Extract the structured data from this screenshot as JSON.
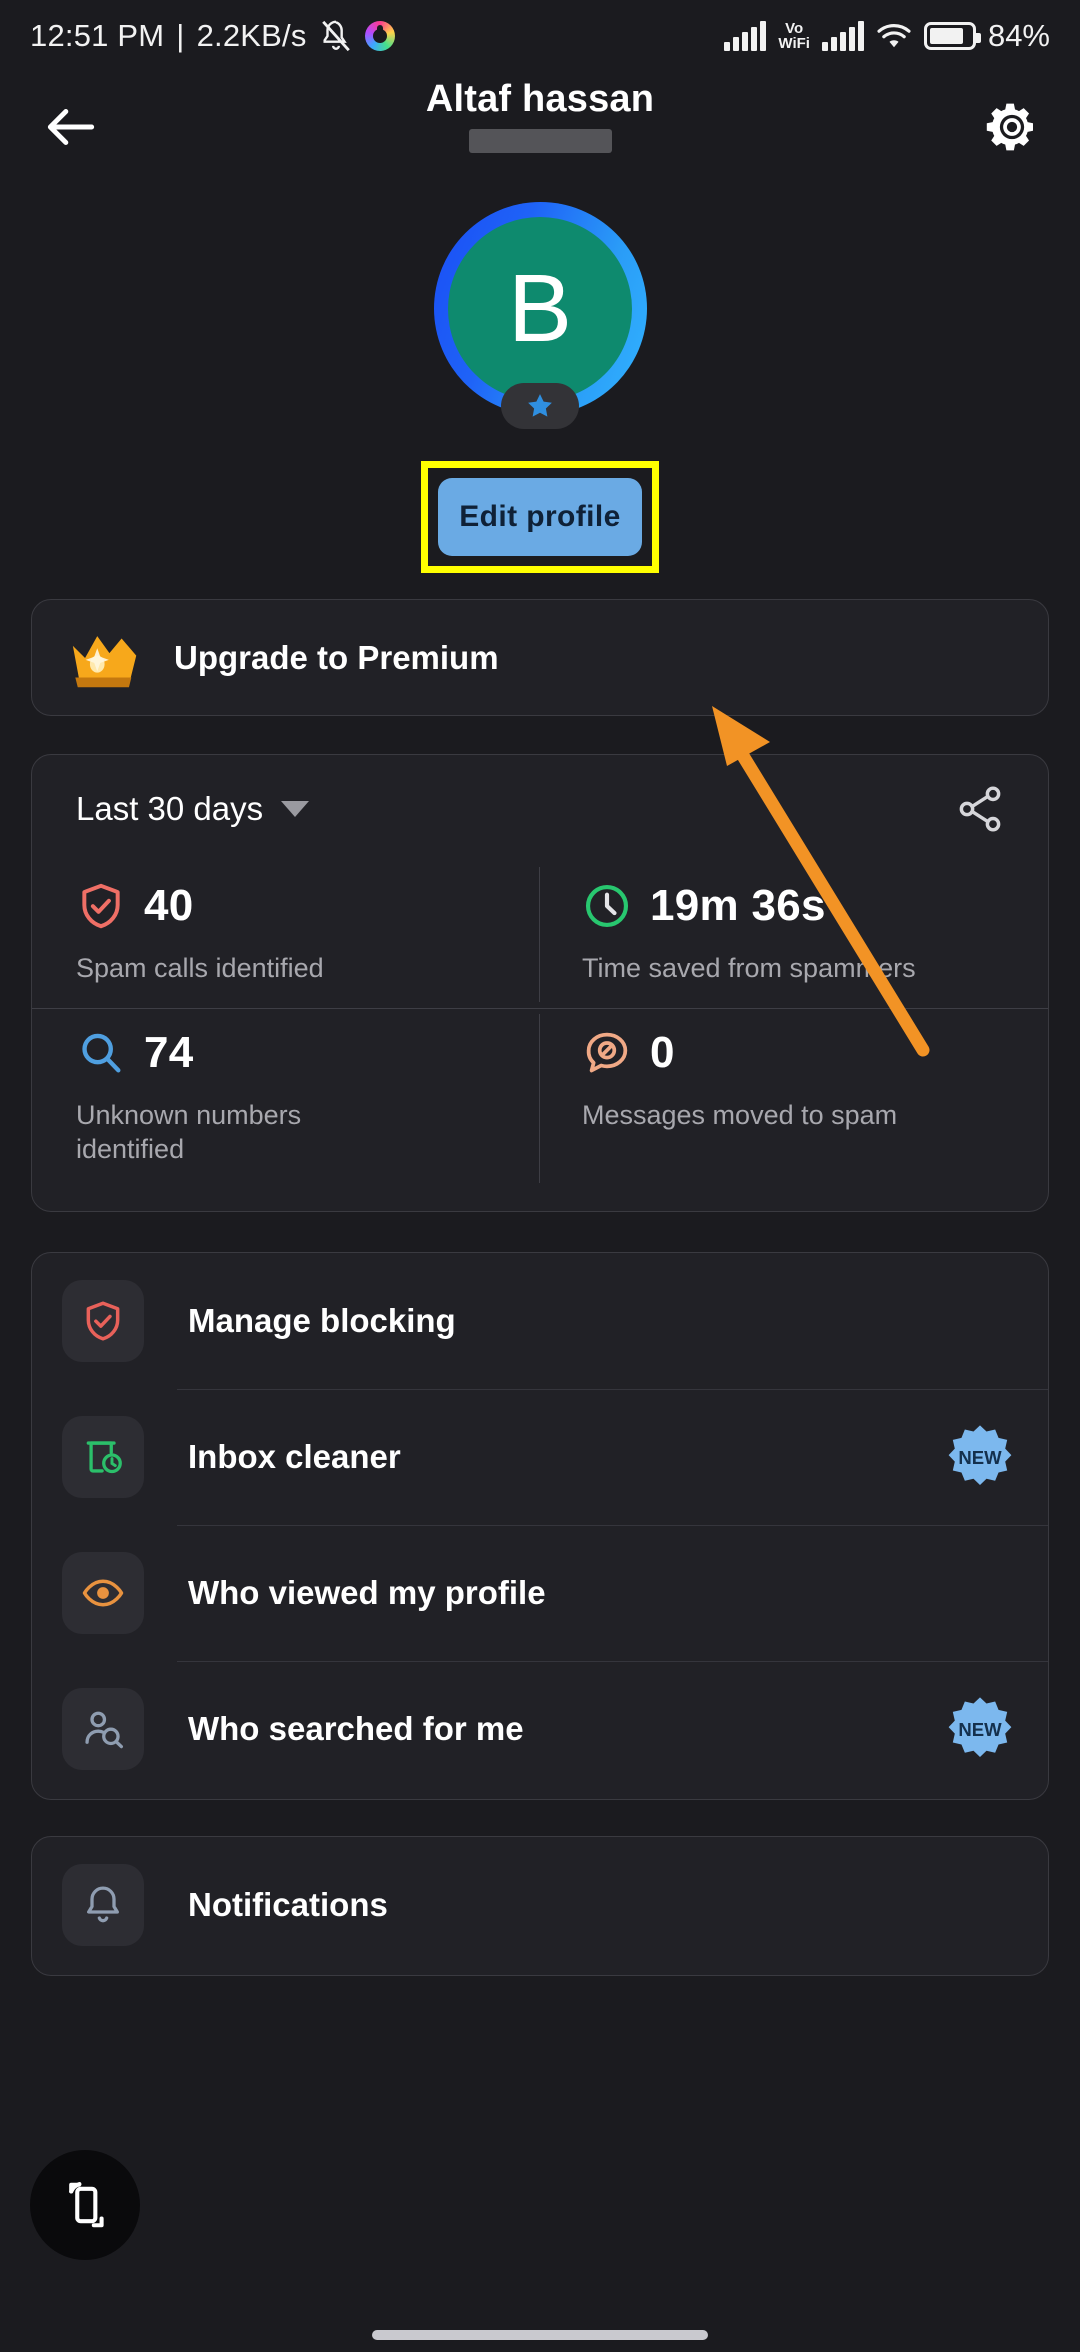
{
  "status_bar": {
    "time": "12:51 PM",
    "separator": "|",
    "network_speed": "2.2KB/s",
    "mute_icon": "bell-muted-icon",
    "app_icon": "spiral-app-icon",
    "signal_icon": "signal-bars-icon",
    "volte_line1": "Vo",
    "volte_line2": "WiFi",
    "signal2_icon": "signal-bars-2-icon",
    "wifi_icon": "wifi-icon",
    "battery_icon": "battery-icon",
    "battery_percent": "84%"
  },
  "app_bar": {
    "back_icon": "back-arrow-icon",
    "title": "Altaf hassan",
    "subtitle_redacted": "",
    "settings_icon": "gear-icon"
  },
  "profile": {
    "avatar_letter": "B",
    "avatar_bg_color": "#0e8a6e",
    "ring_color_start": "#1a4ef5",
    "ring_color_end": "#32b4ff",
    "badge_icon": "star-icon",
    "badge_color": "#2f8fe0",
    "edit_profile_label": "Edit profile",
    "edit_button_color": "#6aaae4",
    "highlight_color": "#ffff00"
  },
  "premium": {
    "icon": "crown-icon",
    "label": "Upgrade to Premium"
  },
  "stats": {
    "range_label": "Last 30 days",
    "range_caret_icon": "chevron-down-icon",
    "share_icon": "share-icon",
    "items": [
      {
        "icon": "shield-check-icon",
        "icon_color": "#ef6f66",
        "value": "40",
        "label": "Spam calls identified"
      },
      {
        "icon": "clock-icon",
        "icon_color": "#28c76f",
        "value": "19m 36s",
        "label": "Time saved from spammers"
      },
      {
        "icon": "magnifier-icon",
        "icon_color": "#4f9fe0",
        "value": "74",
        "label": "Unknown numbers identified"
      },
      {
        "icon": "message-block-icon",
        "icon_color": "#f0a986",
        "value": "0",
        "label": "Messages moved to spam"
      }
    ]
  },
  "menu": {
    "group1": [
      {
        "icon": "shield-check-icon",
        "icon_color": "#e8615a",
        "label": "Manage blocking",
        "badge": ""
      },
      {
        "icon": "inbox-clock-icon",
        "icon_color": "#2bbf6a",
        "label": "Inbox cleaner",
        "badge": "NEW"
      },
      {
        "icon": "eye-icon",
        "icon_color": "#e8923f",
        "label": "Who viewed my profile",
        "badge": ""
      },
      {
        "icon": "person-search-icon",
        "icon_color": "#7f8fa6",
        "label": "Who searched for me",
        "badge": "NEW"
      }
    ],
    "group2": [
      {
        "icon": "bell-icon",
        "icon_color": "#7f8fa6",
        "label": "Notifications",
        "badge": ""
      }
    ]
  },
  "overlay": {
    "rotate_fab_icon": "screen-rotate-icon",
    "arrow_color": "#f29325",
    "arrow_name": "annotation-arrow"
  }
}
